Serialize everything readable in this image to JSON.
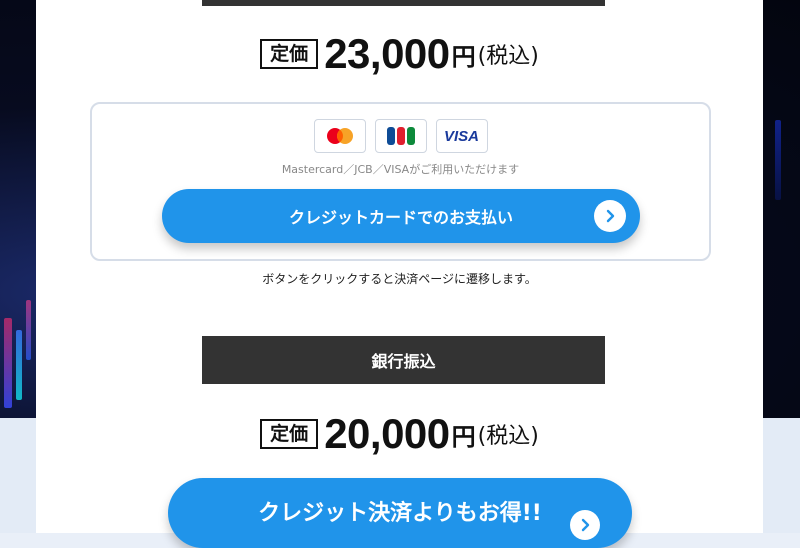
{
  "credit_section": {
    "price_tag": "定価",
    "price_amount": "23,000",
    "price_yen": "円",
    "price_tax": "(税込)",
    "brand_icons": [
      "mastercard-icon",
      "jcb-icon",
      "visa-icon"
    ],
    "visa_label": "VISA",
    "card_note": "Mastercard／JCB／VISAがご利用いただけます",
    "button_label": "クレジットカードでのお支払い",
    "redirect_note": "ボタンをクリックすると決済ページに遷移します。"
  },
  "bank_section": {
    "heading": "銀行振込",
    "price_tag": "定価",
    "price_amount": "20,000",
    "price_yen": "円",
    "price_tax": "(税込)",
    "button_label": "クレジット決済よりもお得!!"
  },
  "colors": {
    "accent_blue": "#2094ea",
    "header_dark": "#333333",
    "mastercard_red": "#eb001b",
    "mastercard_orange": "#f79e1b",
    "jcb_blue": "#0e4c96",
    "jcb_red": "#e01f2e",
    "jcb_green": "#0d8a3b"
  }
}
